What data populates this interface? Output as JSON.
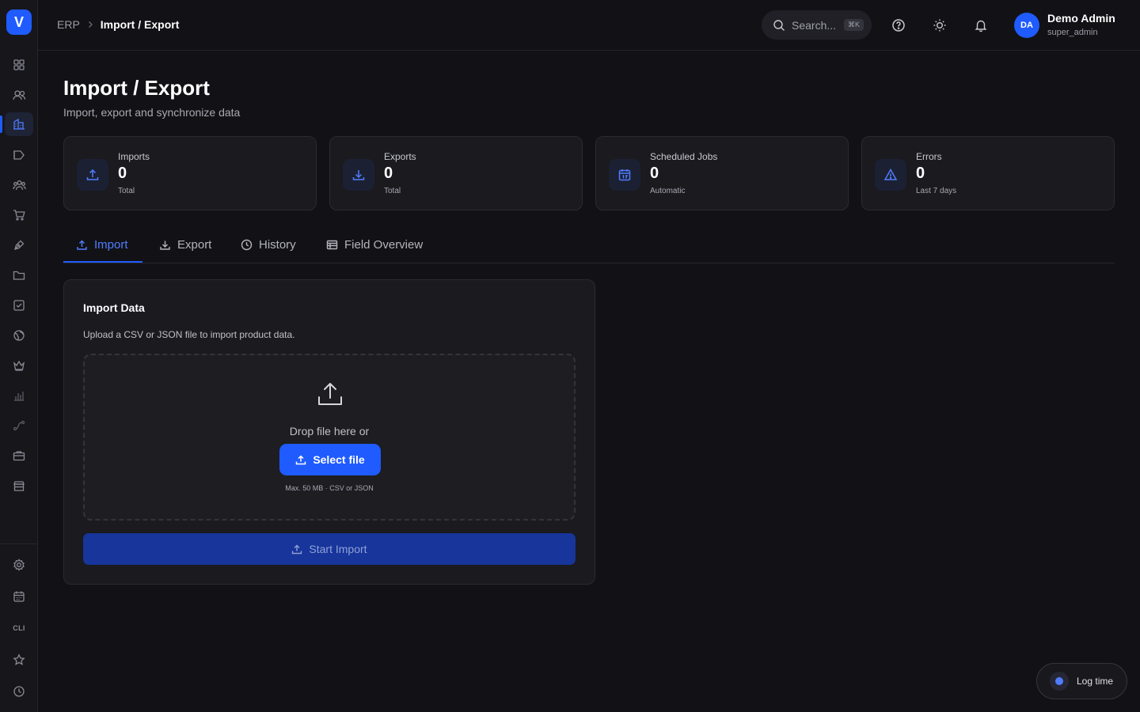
{
  "app": {
    "logo_letter": "V",
    "accent": "#1f5bff"
  },
  "sidebar": {
    "items": [
      {
        "icon": "grid-icon"
      },
      {
        "icon": "users-icon"
      },
      {
        "icon": "building-icon",
        "active": true
      },
      {
        "icon": "tag-icon"
      },
      {
        "icon": "team-icon"
      },
      {
        "icon": "cart-icon"
      },
      {
        "icon": "pen-icon"
      },
      {
        "icon": "folder-icon"
      },
      {
        "icon": "checkbox-icon"
      },
      {
        "icon": "globe-icon"
      },
      {
        "icon": "crown-icon"
      },
      {
        "icon": "bar-chart-icon"
      },
      {
        "icon": "route-icon"
      },
      {
        "icon": "briefcase-icon"
      },
      {
        "icon": "store-icon"
      }
    ],
    "bottom_items": [
      {
        "icon": "gear-icon"
      },
      {
        "icon": "calendar-icon"
      },
      {
        "icon": "cli-icon",
        "label": "CLI"
      },
      {
        "icon": "star-icon"
      },
      {
        "icon": "clock-icon"
      }
    ]
  },
  "header": {
    "breadcrumb": {
      "root": "ERP",
      "separator": ">",
      "current": "Import / Export"
    },
    "search": {
      "placeholder": "Search...",
      "shortcut": "⌘K"
    },
    "user": {
      "initials": "DA",
      "name": "Demo Admin",
      "role": "super_admin"
    }
  },
  "page": {
    "title": "Import / Export",
    "subtitle": "Import, export and synchronize data"
  },
  "stats": [
    {
      "label": "Imports",
      "value": "0",
      "sub": "Total",
      "icon": "upload-icon"
    },
    {
      "label": "Exports",
      "value": "0",
      "sub": "Total",
      "icon": "download-icon"
    },
    {
      "label": "Scheduled Jobs",
      "value": "0",
      "sub": "Automatic",
      "icon": "calendar-icon"
    },
    {
      "label": "Errors",
      "value": "0",
      "sub": "Last 7 days",
      "icon": "warning-icon"
    }
  ],
  "tabs": [
    {
      "label": "Import",
      "icon": "upload-icon",
      "active": true
    },
    {
      "label": "Export",
      "icon": "download-icon"
    },
    {
      "label": "History",
      "icon": "clock-icon"
    },
    {
      "label": "Field Overview",
      "icon": "table-icon"
    }
  ],
  "import_panel": {
    "title": "Import Data",
    "description": "Upload a CSV or JSON file to import product data.",
    "drop_text": "Drop file here or",
    "select_label": "Select file",
    "hint": "Max. 50 MB · CSV or JSON",
    "start_label": "Start Import"
  },
  "log_time": {
    "label": "Log time"
  }
}
